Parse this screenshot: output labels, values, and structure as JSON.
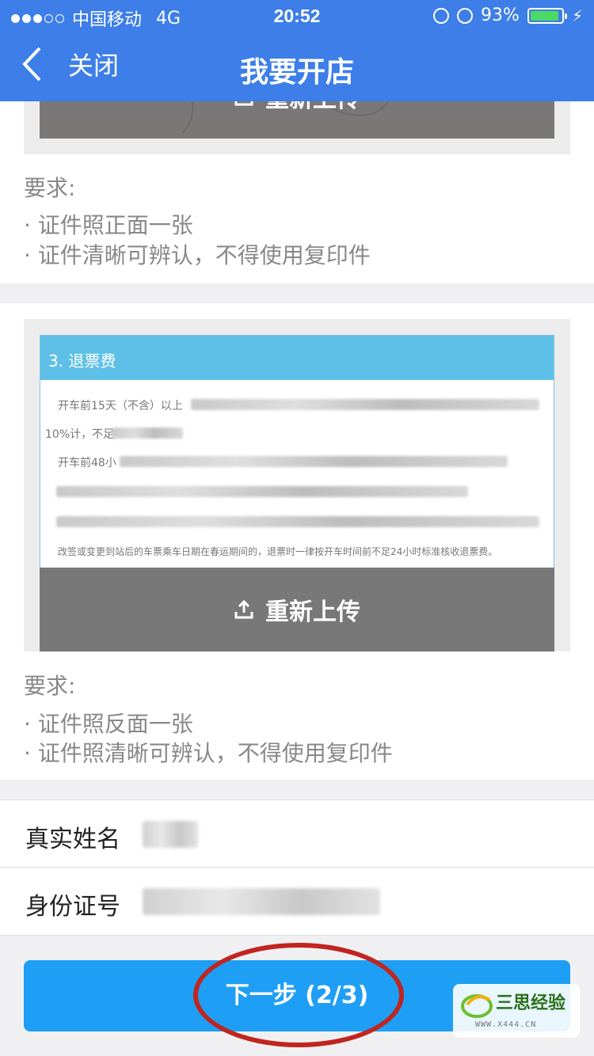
{
  "status": {
    "carrier": "中国移动",
    "network": "4G",
    "time": "20:52",
    "battery": "93%",
    "battery_level": 0.93,
    "signal_bars": 3
  },
  "nav": {
    "back_label": "关闭",
    "title": "我要开店"
  },
  "cards": [
    {
      "reupload_label": "重新上传",
      "requirements_title": "要求:",
      "requirements": [
        "· 证件照正面一张",
        "· 证件清晰可辨认，不得使用复印件"
      ]
    },
    {
      "doc_header": "3. 退票费",
      "doc_line1": "开车前15天（不含）以上",
      "doc_line2": "10%计，不足",
      "doc_line3": "开车前48小",
      "doc_line4": "改签或变更到站后的车票乘车日期在春运期间的，退票时一律按开车时间前不足24小时标准核收退票费。",
      "reupload_label": "重新上传",
      "requirements_title": "要求:",
      "requirements": [
        "· 证件照反面一张",
        "· 证件照清晰可辨认，不得使用复印件"
      ]
    }
  ],
  "form": {
    "name_label": "真实姓名",
    "name_value": "",
    "id_label": "身份证号",
    "id_value": ""
  },
  "next_button": "下一步 (2/3)",
  "watermark": {
    "text": "三思经验",
    "url": "WWW.X444.CN"
  },
  "colors": {
    "nav": "#3d7ee8",
    "button": "#1e9ff5",
    "annotation": "#c0251f"
  }
}
